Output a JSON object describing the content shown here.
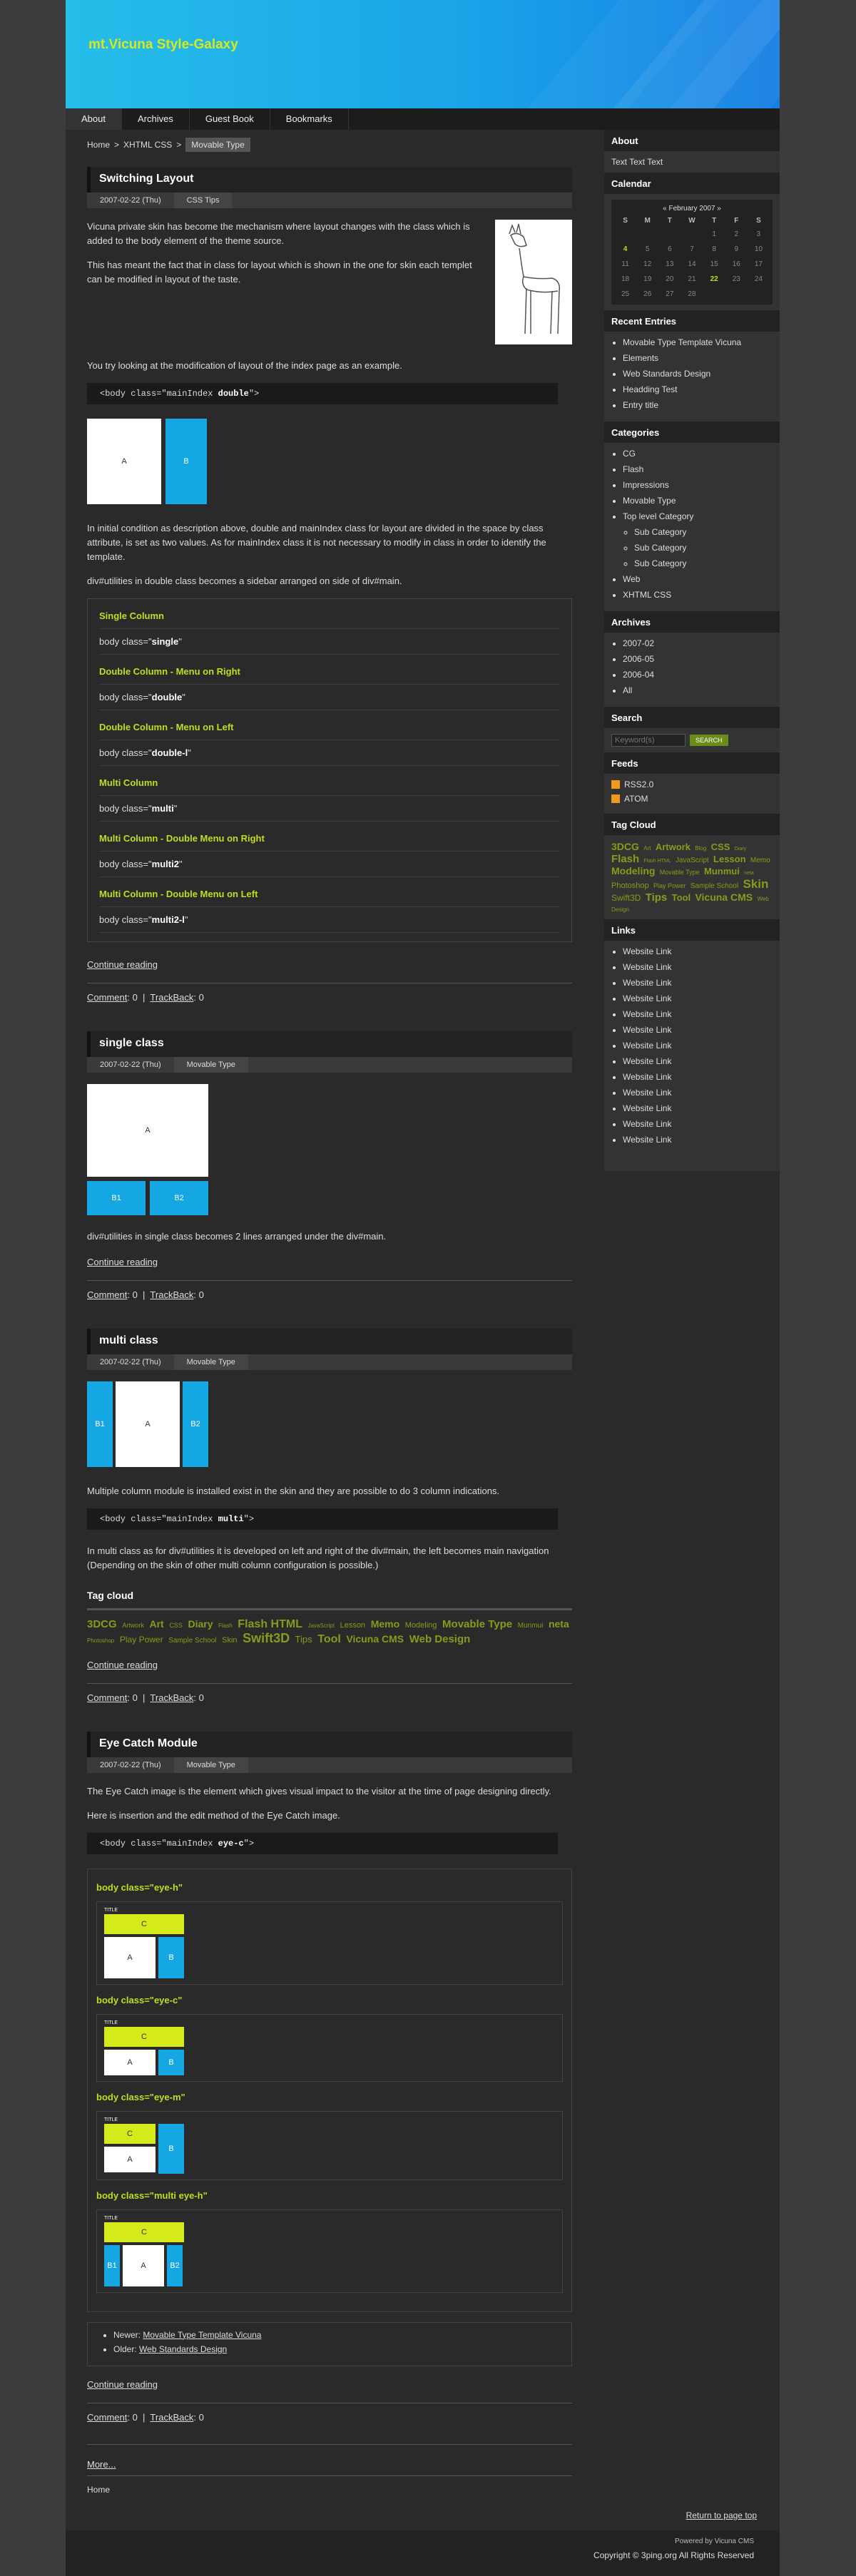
{
  "site": {
    "title": "mt.Vicuna Style-Galaxy",
    "subtitle": ""
  },
  "nav": {
    "items": [
      "About",
      "Archives",
      "Guest Book",
      "Bookmarks"
    ]
  },
  "breadcrumb": {
    "home": "Home",
    "sep1": ">",
    "parent": "XHTML CSS",
    "sep2": ">",
    "current": "Movable Type"
  },
  "entries": {
    "e1": {
      "title": "Switching Layout",
      "date": "2007-02-22 (Thu)",
      "category": "CSS Tips",
      "p1": "Vicuna private skin has become the mechanism where layout changes with the class which is added to the body element of the theme source.",
      "p2": "This has meant the fact that in class for layout which is shown in the one for skin each templet can be modified in layout of the taste.",
      "p3": "You try looking at the modification of layout of the index page as an example.",
      "code_pre": "<body class=\"mainIndex ",
      "code_bold": "double",
      "code_post": "\">",
      "box_a": "A",
      "box_b": "B",
      "p4": "In initial condition as description above, double and mainIndex class for layout are divided in the space by class attribute, is set as two values. As for mainIndex class it is not necessary to modify in class in order to identify the template.",
      "p5": "div#utilities in double class becomes a sidebar arranged on side of div#main.",
      "classes": [
        {
          "title": "Single Column",
          "pre": "body class=\"",
          "bold": "single",
          "post": "\""
        },
        {
          "title": "Double Column - Menu on Right",
          "pre": "body class=\"",
          "bold": "double",
          "post": "\""
        },
        {
          "title": "Double Column - Menu on Left",
          "pre": "body class=\"",
          "bold": "double-l",
          "post": "\""
        },
        {
          "title": "Multi Column",
          "pre": "body class=\"",
          "bold": "multi",
          "post": "\""
        },
        {
          "title": "Multi Column - Double Menu on Right",
          "pre": "body class=\"",
          "bold": "multi2",
          "post": "\""
        },
        {
          "title": "Multi Column - Double Menu on Left",
          "pre": "body class=\"",
          "bold": "multi2-l",
          "post": "\""
        }
      ],
      "more": "Continue reading",
      "comment": "Comment",
      "comment_count": ": 0",
      "trackback": "TrackBack",
      "trackback_count": ": 0"
    },
    "e2": {
      "title": "single class",
      "date": "2007-02-22 (Thu)",
      "category": "Movable Type",
      "box_a": "A",
      "box_b1": "B1",
      "box_b2": "B2",
      "p1": "div#utilities in single class becomes 2 lines arranged under the div#main.",
      "more": "Continue reading",
      "comment": "Comment",
      "comment_count": ": 0",
      "trackback": "TrackBack",
      "trackback_count": ": 0"
    },
    "e3": {
      "title": "multi class",
      "date": "2007-02-22 (Thu)",
      "category": "Movable Type",
      "box_b1": "B1",
      "box_a": "A",
      "box_b2": "B2",
      "p1": "Multiple column module is installed exist in the skin and they are possible to do 3 column indications.",
      "code_pre": "<body class=\"mainIndex ",
      "code_bold": "multi",
      "code_post": "\">",
      "p2": "In multi class as for div#utilities it is developed on left and right of the div#main, the left becomes main navigation (Depending on the skin of other multi column configuration is possible.)",
      "tagcloud_title": "Tag cloud",
      "tags": [
        "3DCG",
        "Artwork",
        "Art",
        "CSS",
        "Diary",
        "Flash",
        "Flash HTML",
        "JavaScript",
        "Lesson",
        "Memo",
        "Modeling",
        "Movable Type",
        "Munmui",
        "neta",
        "Photoshop",
        "Play Power",
        "Sample School",
        "Skin",
        "Swift3D",
        "Tips",
        "Tool",
        "Vicuna CMS",
        "Web Design"
      ],
      "more": "Continue reading",
      "comment": "Comment",
      "comment_count": ": 0",
      "trackback": "TrackBack",
      "trackback_count": ": 0"
    },
    "e4": {
      "title": "Eye Catch Module",
      "date": "2007-02-22 (Thu)",
      "category": "Movable Type",
      "p1": "The Eye Catch image is the element which gives visual impact to the visitor at the time of page designing directly.",
      "p2": "Here is insertion and the edit method of the Eye Catch image.",
      "code_pre": "<body class=\"mainIndex ",
      "code_bold": "eye-c",
      "code_post": "\">",
      "eyecatch": [
        {
          "title": "body class=\"eye-h\"",
          "title_label": "TITLE",
          "c": "C",
          "a": "A",
          "b": "B"
        },
        {
          "title": "body class=\"eye-c\"",
          "title_label": "TITLE",
          "c": "C",
          "a": "A",
          "b": "B"
        },
        {
          "title": "body class=\"eye-m\"",
          "title_label": "TITLE",
          "c": "C",
          "a": "A",
          "b": "B"
        },
        {
          "title": "body class=\"multi eye-h\"",
          "title_label": "TITLE",
          "c": "C",
          "b1": "B1",
          "a": "A",
          "b2": "B2"
        }
      ],
      "newer_label": "Newer:",
      "newer": "Movable Type Template Vicuna",
      "older_label": "Older:",
      "older": "Web Standards Design",
      "more": "Continue reading",
      "comment": "Comment",
      "comment_count": ": 0",
      "trackback": "TrackBack",
      "trackback_count": ": 0"
    }
  },
  "more_link": "More...",
  "home_link": "Home",
  "sidebar": {
    "about_title": "About",
    "about_text": "Text Text Text",
    "calendar_title": "Calendar",
    "calendar": {
      "prev": "«",
      "month": "February 2007",
      "next": "»",
      "days": [
        "S",
        "M",
        "T",
        "W",
        "T",
        "F",
        "S"
      ],
      "weeks": [
        [
          "",
          "",
          "",
          "",
          "1",
          "2",
          "3"
        ],
        [
          "4",
          "5",
          "6",
          "7",
          "8",
          "9",
          "10"
        ],
        [
          "11",
          "12",
          "13",
          "14",
          "15",
          "16",
          "17"
        ],
        [
          "18",
          "19",
          "20",
          "21",
          "22",
          "23",
          "24"
        ],
        [
          "25",
          "26",
          "27",
          "28",
          "",
          "",
          ""
        ]
      ]
    },
    "recent_title": "Recent Entries",
    "recent": [
      "Movable Type Template Vicuna",
      "Elements",
      "Web Standards Design",
      "Headding Test",
      "Entry title"
    ],
    "categories_title": "Categories",
    "categories": [
      "CG",
      "Flash",
      "Impressions",
      "Movable Type",
      "Top level Category"
    ],
    "subcategories": [
      "Sub Category",
      "Sub Category",
      "Sub Category"
    ],
    "categories2": [
      "Web",
      "XHTML CSS"
    ],
    "archives_title": "Archives",
    "archives": [
      "2007-02",
      "2006-05",
      "2006-04",
      "All"
    ],
    "search_title": "Search",
    "search_placeholder": "Keyword(s)",
    "search_button": "SEARCH",
    "feeds_title": "Feeds",
    "feeds": [
      "RSS2.0",
      "ATOM"
    ],
    "tagcloud_title": "Tag Cloud",
    "tags": [
      "3DCG",
      "Art",
      "Artwork",
      "Blog",
      "CSS",
      "Diary",
      "Flash",
      "Flash HTML",
      "JavaScript",
      "Lesson",
      "Memo",
      "Modeling",
      "Movable Type",
      "Munmui",
      "neta",
      "Photoshop",
      "Play Power",
      "Sample School",
      "Skin",
      "Swift3D",
      "Tips",
      "Tool",
      "Vicuna CMS",
      "Web Design"
    ],
    "links_title": "Links",
    "links": [
      "Website Link",
      "Website Link",
      "Website Link",
      "Website Link",
      "Website Link",
      "Website Link",
      "Website Link",
      "Website Link",
      "Website Link",
      "Website Link",
      "Website Link",
      "Website Link",
      "Website Link"
    ]
  },
  "footer": {
    "pagetop": "Return to page top",
    "powered": "Powered by Vicuna CMS",
    "copyright": "Copyright © 3ping.org All Rights Reserved"
  }
}
